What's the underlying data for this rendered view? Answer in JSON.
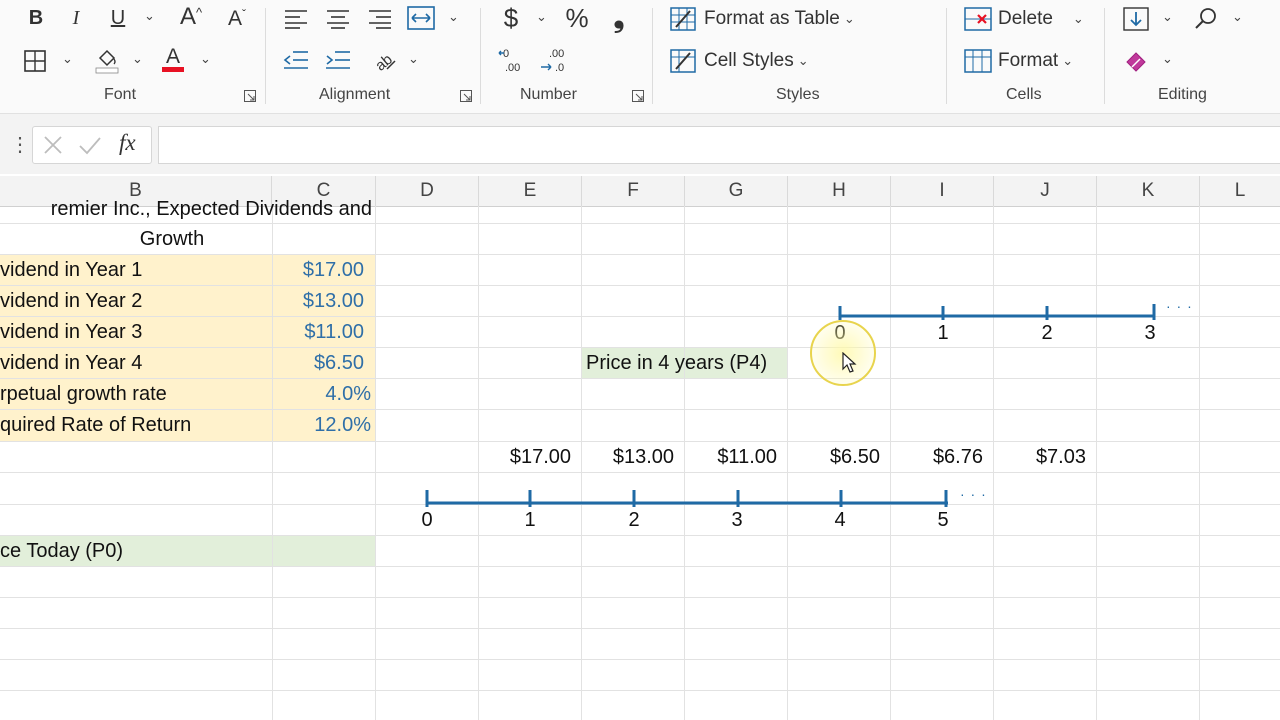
{
  "ribbon": {
    "groups": [
      {
        "name": "Font"
      },
      {
        "name": "Alignment"
      },
      {
        "name": "Number"
      },
      {
        "name": "Styles"
      },
      {
        "name": "Cells"
      },
      {
        "name": "Editing"
      }
    ],
    "bold": "B",
    "italic": "I",
    "underline": "U",
    "grow_font": "A",
    "shrink_font": "A",
    "currency": "$",
    "percent": "%",
    "comma": "❟",
    "format_as_table": "Format as Table",
    "cell_styles": "Cell Styles",
    "delete": "Delete",
    "format": "Format"
  },
  "formula_bar": {
    "fx": "fx",
    "value": ""
  },
  "columns": [
    "B",
    "C",
    "D",
    "E",
    "F",
    "G",
    "H",
    "I",
    "J",
    "K",
    "L"
  ],
  "sheet": {
    "title_line1": "remier Inc., Expected Dividends and",
    "title_line2": "Growth",
    "rows": [
      {
        "label": "vidend in Year 1",
        "value": "$17.00"
      },
      {
        "label": "vidend in Year 2",
        "value": "$13.00"
      },
      {
        "label": "vidend in Year 3",
        "value": "$11.00"
      },
      {
        "label": "vidend in Year 4",
        "value": "$6.50"
      },
      {
        "label": "rpetual growth rate",
        "value": "4.0%"
      },
      {
        "label": "quired Rate of Return",
        "value": "12.0%"
      }
    ],
    "price_p4": "Price in 4 years (P4)",
    "price_today": "ce Today (P0)",
    "cash_flows": [
      "$17.00",
      "$13.00",
      "$11.00",
      "$6.50",
      "$6.76",
      "$7.03"
    ],
    "upper_timeline_labels": [
      "0",
      "1",
      "2",
      "3"
    ],
    "lower_timeline_labels": [
      "0",
      "1",
      "2",
      "3",
      "4",
      "5"
    ],
    "ellipsis": "· · ·"
  },
  "colors": {
    "label_fill": "#fff2cc",
    "green_fill": "#e2efda",
    "value_blue": "#2f6fa8",
    "timeline_blue": "#1f6aa5",
    "font_red": "#e81123",
    "cursor_highlight": "#fff9a6"
  }
}
